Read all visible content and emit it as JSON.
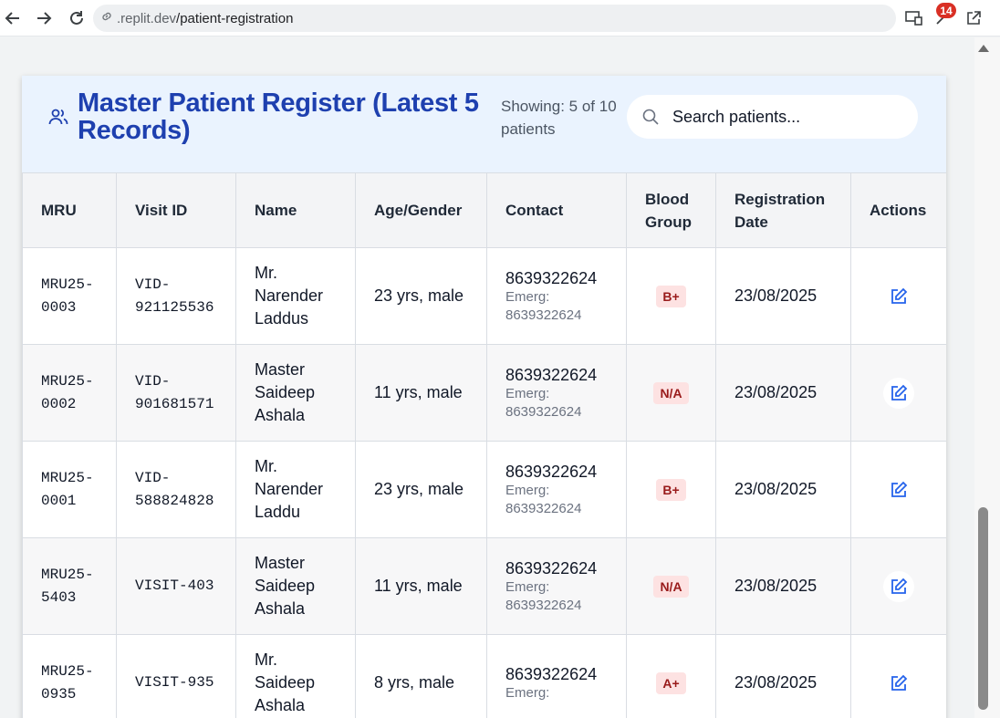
{
  "browser": {
    "url_host": ".replit.dev",
    "url_path": "/patient-registration",
    "notification_count": "14"
  },
  "header": {
    "title": "Master Patient Register (Latest 5 Records)",
    "showing": "Showing: 5 of 10 patients",
    "search_placeholder": "Search patients..."
  },
  "table": {
    "columns": [
      "MRU",
      "Visit ID",
      "Name",
      "Age/Gender",
      "Contact",
      "Blood Group",
      "Registration Date",
      "Actions"
    ],
    "rows": [
      {
        "mru": "MRU25-0003",
        "visit_id": "VID-921125536",
        "name": "Mr. Narender Laddus",
        "age_gender": "23 yrs, male",
        "contact": "8639322624",
        "emerg_label": "Emerg:",
        "emerg": "8639322624",
        "blood": "B+",
        "date": "23/08/2025"
      },
      {
        "mru": "MRU25-0002",
        "visit_id": "VID-901681571",
        "name": "Master Saideep Ashala",
        "age_gender": "11 yrs, male",
        "contact": "8639322624",
        "emerg_label": "Emerg:",
        "emerg": "8639322624",
        "blood": "N/A",
        "date": "23/08/2025"
      },
      {
        "mru": "MRU25-0001",
        "visit_id": "VID-588824828",
        "name": "Mr. Narender Laddu",
        "age_gender": "23 yrs, male",
        "contact": "8639322624",
        "emerg_label": "Emerg:",
        "emerg": "8639322624",
        "blood": "B+",
        "date": "23/08/2025"
      },
      {
        "mru": "MRU25-5403",
        "visit_id": "VISIT-403",
        "name": "Master Saideep Ashala",
        "age_gender": "11 yrs, male",
        "contact": "8639322624",
        "emerg_label": "Emerg:",
        "emerg": "8639322624",
        "blood": "N/A",
        "date": "23/08/2025"
      },
      {
        "mru": "MRU25-0935",
        "visit_id": "VISIT-935",
        "name": "Mr. Saideep Ashala",
        "age_gender": "8 yrs, male",
        "contact": "8639322624",
        "emerg_label": "Emerg:",
        "emerg": "",
        "blood": "A+",
        "date": "23/08/2025"
      }
    ]
  },
  "colors": {
    "title": "#1e40af",
    "header_bg": "#eaf3fe",
    "badge_bg": "#fde2e2",
    "badge_text": "#991b1b",
    "edit_icon": "#2563eb"
  },
  "icons": {
    "back": "arrow-left-icon",
    "forward": "arrow-right-icon",
    "reload": "reload-icon",
    "link": "link-icon",
    "users": "users-icon",
    "search": "search-icon",
    "edit": "edit-icon"
  }
}
